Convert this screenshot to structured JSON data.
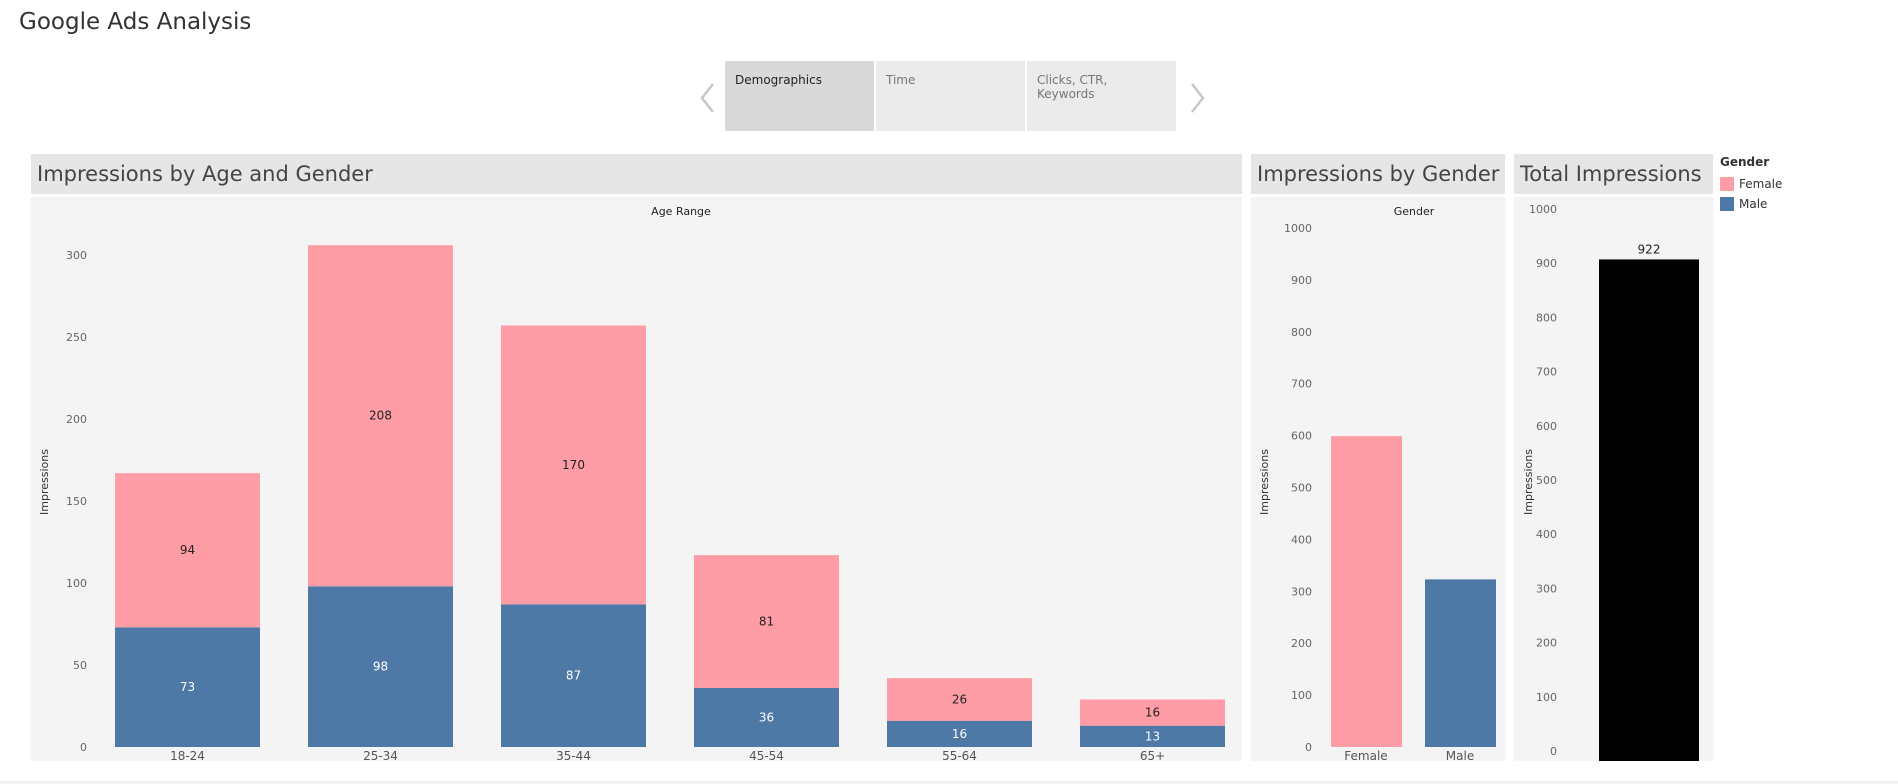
{
  "page": {
    "title": "Google Ads Analysis"
  },
  "story": {
    "tabs": [
      {
        "label": "Demographics",
        "active": true
      },
      {
        "label": "Time",
        "active": false
      },
      {
        "label": "Clicks, CTR, Keywords",
        "active": false
      }
    ]
  },
  "colors": {
    "female": "#ff9da7",
    "male": "#4e79a7",
    "total": "#000000"
  },
  "legend": {
    "title": "Gender",
    "items": [
      {
        "label": "Female",
        "color": "#ff9da7"
      },
      {
        "label": "Male",
        "color": "#4e79a7"
      }
    ]
  },
  "chart_data": [
    {
      "type": "bar",
      "stacked": true,
      "title": "Impressions by Age and Gender",
      "header": "Age Range",
      "ylabel": "Impressions",
      "ylim": [
        0,
        300
      ],
      "yticks": [
        0,
        50,
        100,
        150,
        200,
        250,
        300
      ],
      "categories": [
        "18-24",
        "25-34",
        "35-44",
        "45-54",
        "55-64",
        "65+"
      ],
      "series": [
        {
          "name": "Male",
          "values": [
            73,
            98,
            87,
            36,
            16,
            13
          ]
        },
        {
          "name": "Female",
          "values": [
            94,
            208,
            170,
            81,
            26,
            16
          ]
        }
      ]
    },
    {
      "type": "bar",
      "title": "Impressions by Gender",
      "header": "Gender",
      "ylabel": "Impressions",
      "ylim": [
        0,
        1000
      ],
      "yticks": [
        0,
        100,
        200,
        300,
        400,
        500,
        600,
        700,
        800,
        900,
        1000
      ],
      "categories": [
        "Female",
        "Male"
      ],
      "values": [
        599,
        323
      ]
    },
    {
      "type": "bar",
      "title": "Total Impressions",
      "ylabel": "Impressions",
      "ylim": [
        0,
        1000
      ],
      "yticks": [
        0,
        100,
        200,
        300,
        400,
        500,
        600,
        700,
        800,
        900,
        1000
      ],
      "values": [
        922
      ],
      "data_labels": [
        "922"
      ]
    }
  ]
}
